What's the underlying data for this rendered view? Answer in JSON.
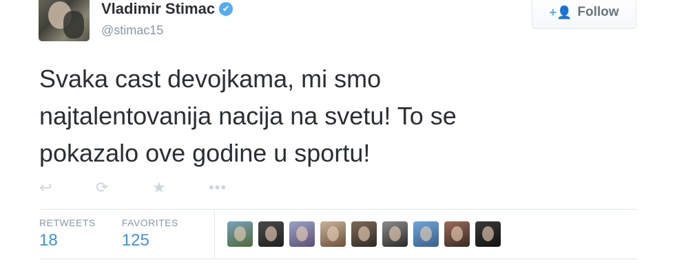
{
  "author": {
    "full_name": "Vladimir Stimac",
    "screen_name": "@stimac15",
    "verified_icon": "✔"
  },
  "follow_button": {
    "label": "Follow",
    "icon": "+👤"
  },
  "tweet": {
    "lines": [
      "Svaka cast devojkama, mi smo",
      "najtalentovanija nacija na svetu! To se",
      "pokazalo ove godine u sportu!"
    ]
  },
  "actions": {
    "reply": "↩",
    "retweet": "⟳",
    "favorite": "★",
    "more": "•••"
  },
  "stats": {
    "retweets_label": "RETWEETS",
    "retweets_value": "18",
    "favorites_label": "FAVORITES",
    "favorites_value": "125"
  },
  "favoriter_avatars": [
    {
      "colors": [
        "#7aa0b8",
        "#4d6b3a"
      ]
    },
    {
      "colors": [
        "#4a4a4a",
        "#1f1f1f"
      ]
    },
    {
      "colors": [
        "#9aa3c2",
        "#5a4f7a"
      ]
    },
    {
      "colors": [
        "#c7b49a",
        "#6e4f3a"
      ]
    },
    {
      "colors": [
        "#7d6a58",
        "#2f2a25"
      ]
    },
    {
      "colors": [
        "#8c8c8c",
        "#2a2a2a"
      ]
    },
    {
      "colors": [
        "#6fa4d8",
        "#3b5f8a"
      ]
    },
    {
      "colors": [
        "#9a6a5a",
        "#3a2a24"
      ]
    },
    {
      "colors": [
        "#3a3a3a",
        "#111111"
      ]
    }
  ]
}
